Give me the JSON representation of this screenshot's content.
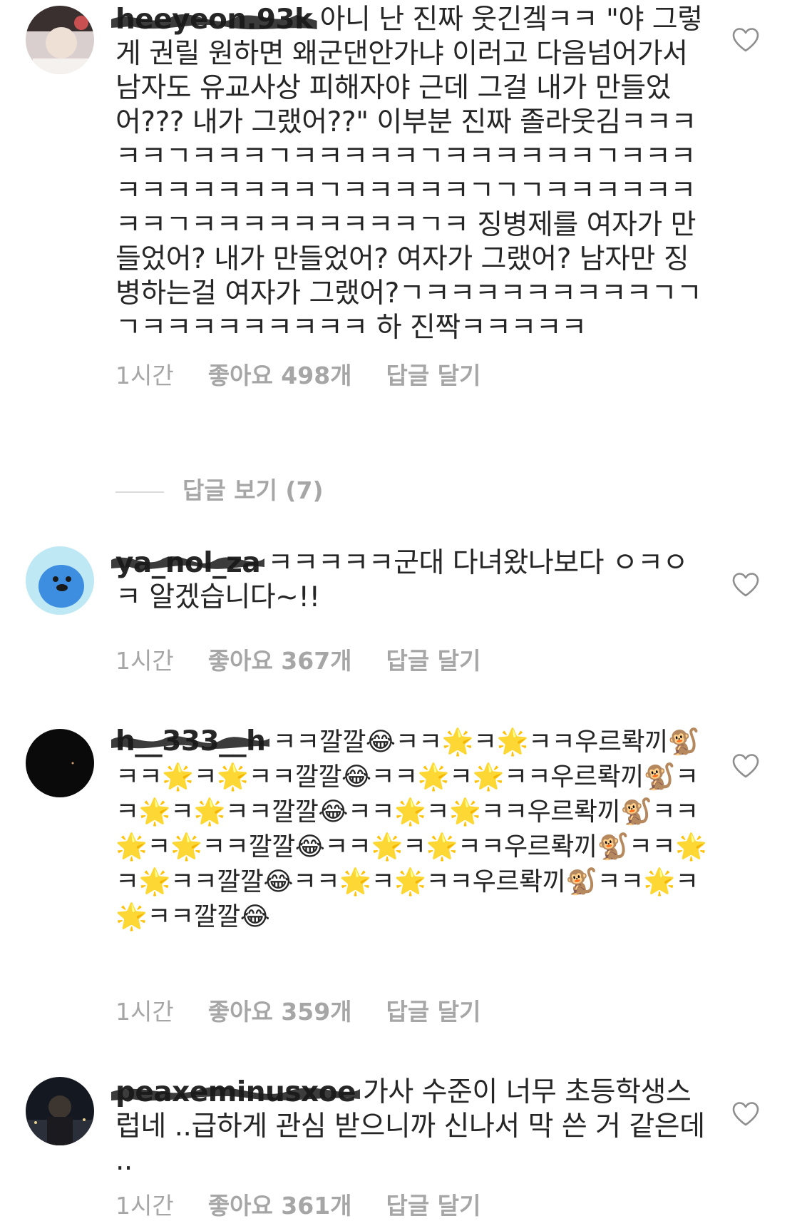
{
  "comments": [
    {
      "username": "heeyeon.93k",
      "text": "아니 난 진짜 웃긴겤ㅋㅋ \"야 그렇게 권릴 원하면 왜군댄안가냐 이러고 다음넘어가서 남자도 유교사상 피해자야 근데 그걸 내가 만들었어??? 내가 그랬어??\" 이부분 진짜 졸라웃김ㅋㅋㅋㅋㅋㄱㅋㅋㅋㄱㅋㅋㅋㅋㅋㄱㅋㅋㅋㅋㅋㅋㄱㅋㅋㅋㅋㅋㅋㅋㅋㅋㅋㅋㄱㅋㅋㅋㅋㅋㄱㄱㄱㅋㅋㅋㅋㅋㅋㅋㅋㄱㅋㅋㅋㅋㅋㅋㅋㅋㅋㄱㅋ 징병제를 여자가 만들었어? 내가 만들었어? 여자가 그랬어? 남자만 징병하는걸 여자가 그랬어?ㄱㅋㅋㅋㅋㅋㅋㅋㅋㅋㄱㄱㄱㅋㅋㅋㅋㅋㅋㅋㅋㅋ 하 진짝ㅋㅋㅋㅋㅋ",
      "time": "1시간",
      "likes": "좋아요 498개",
      "reply": "답글 달기"
    },
    {
      "username": "ya_nol_za",
      "text": "ㅋㅋㅋㅋㅋ군대 다녀왔나보다 ㅇㅋㅇㅋ 알겠습니다~!!",
      "time": "1시간",
      "likes": "좋아요 367개",
      "reply": "답글 달기"
    },
    {
      "username": "h__333__h",
      "text": "ㅋㅋ깔깔😂ㅋㅋ🌟ㅋ🌟ㅋㅋ우르롹끼🐒ㅋㅋ🌟ㅋ🌟ㅋㅋ깔깔😂ㅋㅋ🌟ㅋ🌟ㅋㅋ우르롹끼🐒ㅋㅋ🌟ㅋ🌟ㅋㅋ깔깔😂ㅋㅋ🌟ㅋ🌟ㅋㅋ우르롹끼🐒ㅋㅋ🌟ㅋ🌟ㅋㅋ깔깔😂ㅋㅋ🌟ㅋ🌟ㅋㅋ우르롹끼🐒ㅋㅋ🌟ㅋ🌟ㅋㅋ깔깔😂ㅋㅋ🌟ㅋ🌟ㅋㅋ우르롹끼🐒ㅋㅋ🌟ㅋ🌟ㅋㅋ깔깔😂",
      "time": "1시간",
      "likes": "좋아요 359개",
      "reply": "답글 달기"
    },
    {
      "username": "peaxeminusxoe",
      "text": "가사 수준이 너무 초등학생스럽네 ..급하게 관심 받으니까 신나서 막 쓴 거 같은데 ..",
      "time": "1시간",
      "likes": "좋아요 361개",
      "reply": "답글 달기"
    }
  ],
  "view_replies": "답글 보기 (7)",
  "icons": {
    "like": "heart-outline-icon"
  }
}
